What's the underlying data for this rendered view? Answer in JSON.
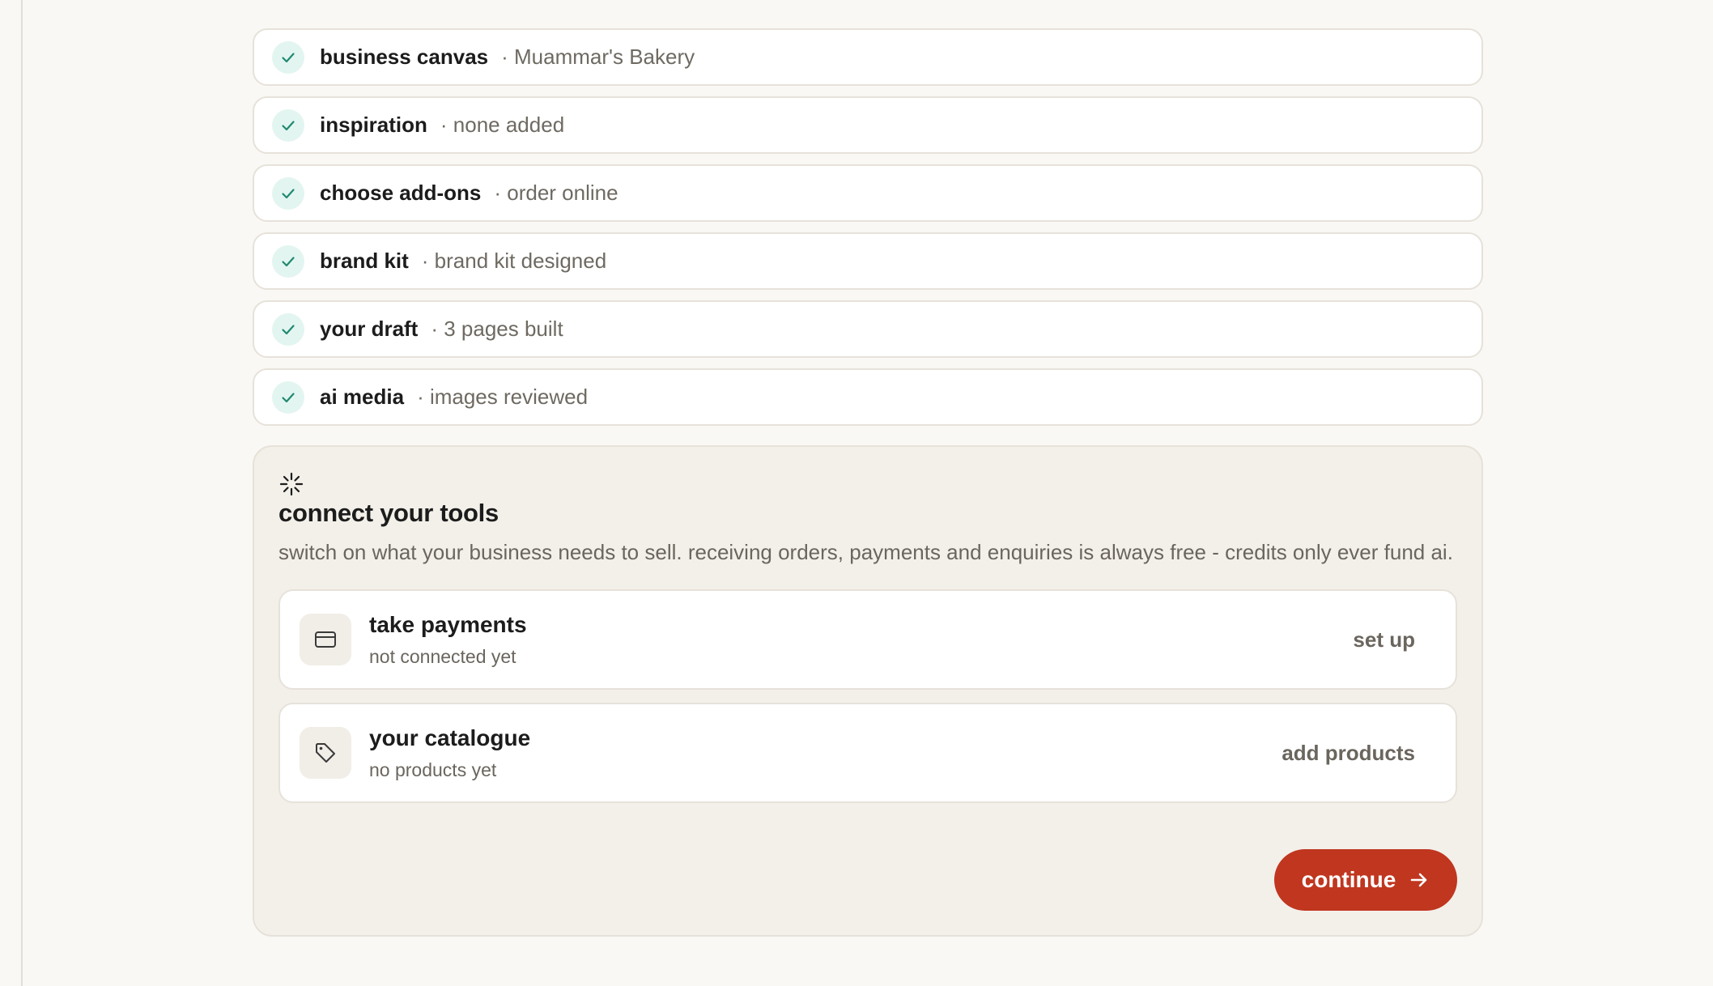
{
  "steps": [
    {
      "title": "business canvas",
      "detail": "· Muammar's Bakery",
      "icon": "check-icon"
    },
    {
      "title": "inspiration",
      "detail": "· none added",
      "icon": "check-icon"
    },
    {
      "title": "choose add-ons",
      "detail": "· order online",
      "icon": "check-icon"
    },
    {
      "title": "brand kit",
      "detail": "· brand kit designed",
      "icon": "check-icon"
    },
    {
      "title": "your draft",
      "detail": "· 3 pages built",
      "icon": "check-icon"
    },
    {
      "title": "ai media",
      "detail": "· images reviewed",
      "icon": "check-icon"
    }
  ],
  "tools": {
    "icon": "sparkle-loading-icon",
    "title": "connect your tools",
    "description": "switch on what your business needs to sell. receiving orders, payments and enquiries is always free - credits only ever fund ai.",
    "cards": [
      {
        "title": "take payments",
        "status": "not connected yet",
        "action": "set up",
        "icon": "credit-card-icon"
      },
      {
        "title": "your catalogue",
        "status": "no products yet",
        "action": "add products",
        "icon": "tag-icon"
      }
    ],
    "continue_label": "continue",
    "continue_icon": "arrow-right-icon"
  },
  "colors": {
    "page_background": "#faf8f4",
    "accent": "#c0361f",
    "check_green": "#1f8a70",
    "check_background": "#e3f5f1",
    "panel_background": "#f3f0ea"
  }
}
